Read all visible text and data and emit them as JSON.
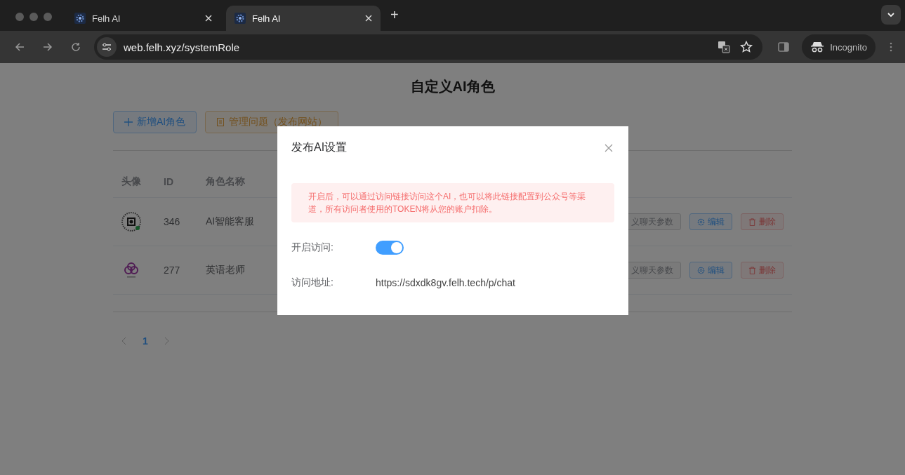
{
  "browser": {
    "tabs": [
      {
        "title": "Felh AI",
        "selected": false
      },
      {
        "title": "Felh AI",
        "selected": true
      }
    ],
    "new_tab": "+",
    "address": "web.felh.xyz/systemRole",
    "profile": "Incognito"
  },
  "page": {
    "title": "自定义AI角色",
    "buttons": [
      {
        "label": "新增AI角色",
        "kind": "primary"
      },
      {
        "label": "管理问题（发布网站）",
        "kind": "warning"
      }
    ],
    "table": {
      "columns": [
        "头像",
        "ID",
        "角色名称"
      ],
      "rows": [
        {
          "kind": "qr",
          "id": "346",
          "name": "AI智能客服",
          "actions": [
            "义聊天参数",
            "编辑",
            "删除"
          ]
        },
        {
          "kind": "logo",
          "id": "277",
          "name": "英语老师",
          "actions": [
            "义聊天参数",
            "编辑",
            "删除"
          ]
        }
      ]
    },
    "pagination": {
      "pages": [
        {
          "label": "1",
          "selected": true
        }
      ]
    }
  },
  "dialog": {
    "title": "发布AI设置",
    "alert": "开启后，可以通过访问链接访问这个AI，也可以将此链接配置到公众号等渠道，所有访问者使用的TOKEN将从您的账户扣除。",
    "fields": [
      {
        "label": "开启访问:",
        "kind": "switch",
        "on": true
      },
      {
        "label": "访问地址:",
        "kind": "text",
        "value": "https://sdxdk8gv.felh.tech/p/chat"
      }
    ]
  }
}
